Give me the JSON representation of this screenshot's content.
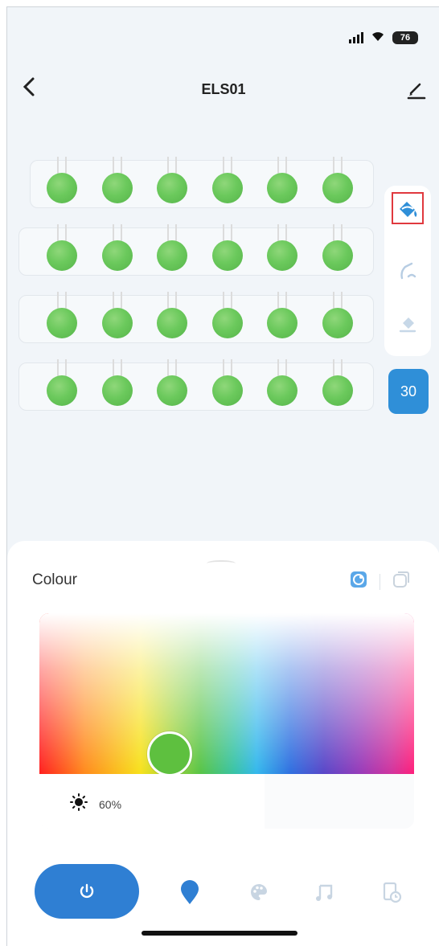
{
  "status_bar": {
    "battery": "76"
  },
  "header": {
    "title": "ELS01"
  },
  "light_grid": {
    "rows": 4,
    "per_row": 6,
    "bulb_color": "#66c657"
  },
  "tools": {
    "selected": "fill-bucket",
    "items": [
      "fill-bucket",
      "brush",
      "eraser"
    ],
    "count_label": "30"
  },
  "colour_panel": {
    "label": "Colour",
    "mode_icons": [
      "colour-wheel-icon",
      "white-light-icon"
    ],
    "selected_color": "#5ec03f",
    "brightness_label": "60%",
    "brightness": 0.6
  },
  "bottom_nav": {
    "items": [
      "power",
      "light-bulb",
      "palette",
      "music",
      "timer"
    ],
    "active": "light-bulb"
  },
  "colors": {
    "accent": "#2f7fd3",
    "count_badge": "#2f8fd8",
    "selection_outline": "#e0393e"
  }
}
